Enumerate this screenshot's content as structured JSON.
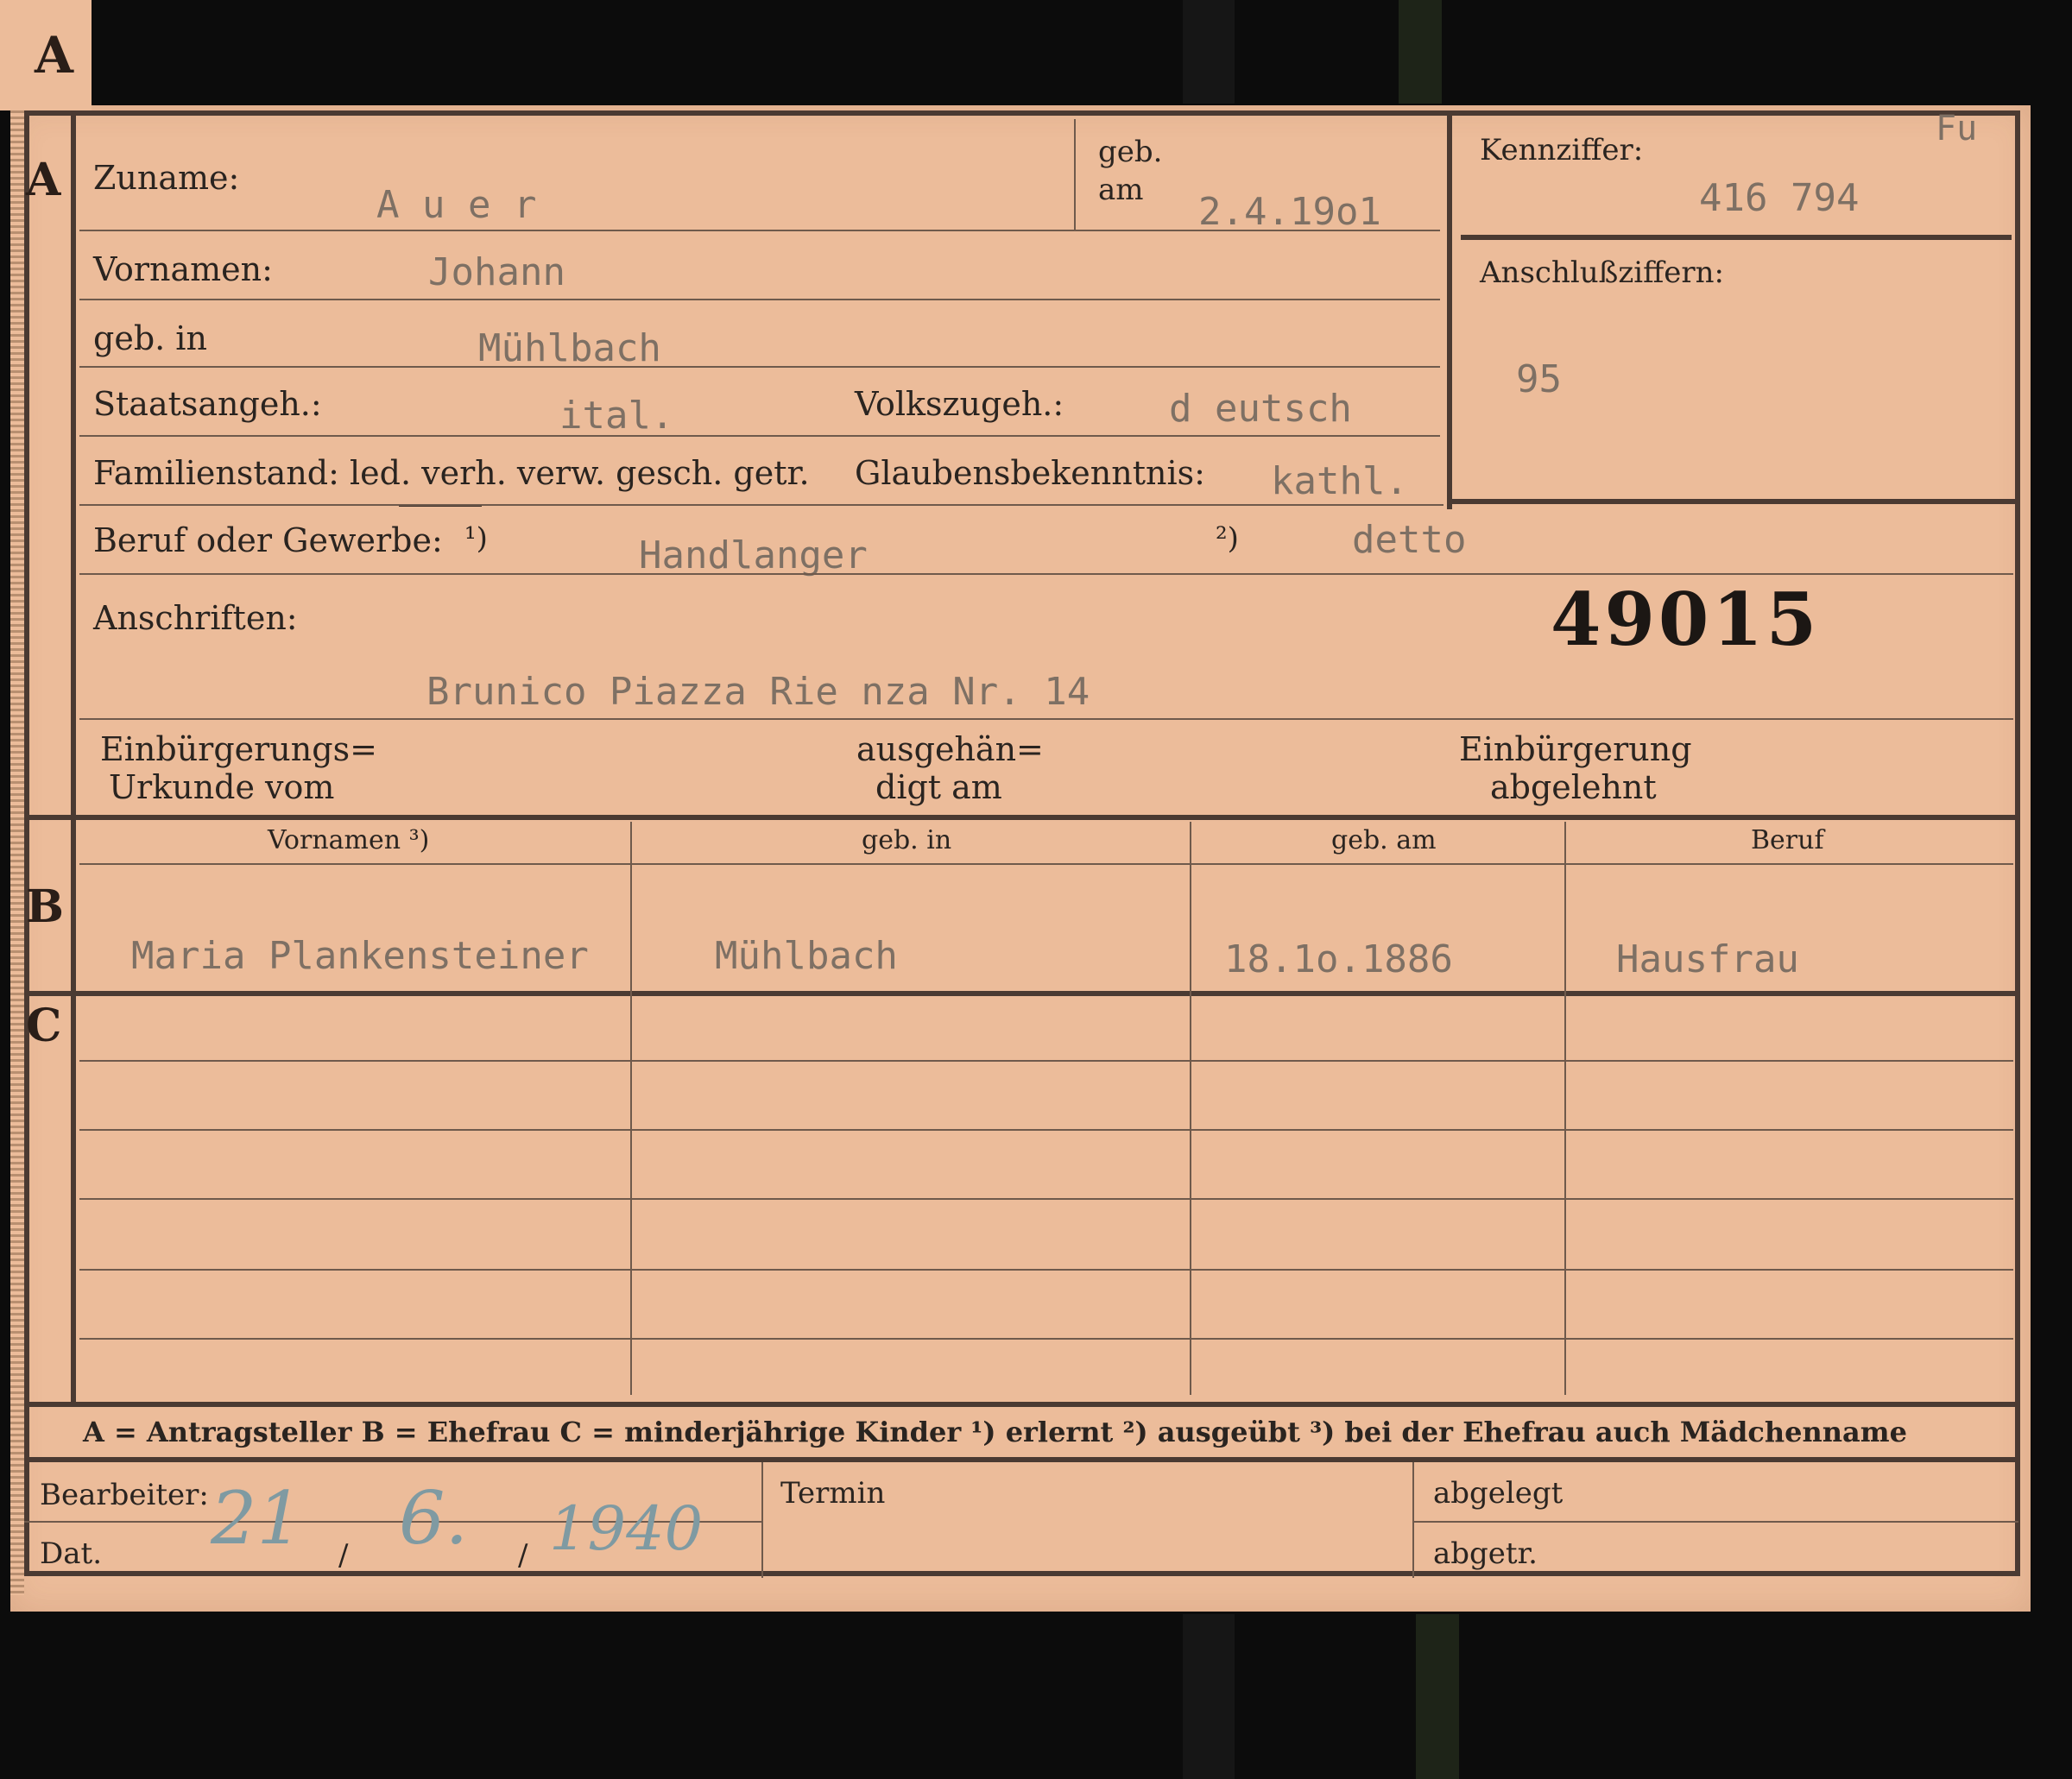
{
  "sections": {
    "a": "A",
    "b": "B",
    "c": "C"
  },
  "top_right_mark": "Fu",
  "applicant": {
    "surname_label": "Zuname:",
    "surname": "A u e r",
    "born_label_1": "geb.",
    "born_label_2": "am",
    "birth_date": "2.4.19o1",
    "firstname_label": "Vornamen:",
    "firstname": "Johann",
    "birthplace_label": "geb. in",
    "birthplace": "Mühlbach",
    "citizenship_label": "Staatsangeh.:",
    "citizenship": "ital.",
    "ethnicity_label": "Volkszugeh.:",
    "ethnicity": "d eutsch",
    "marital_label": "Familienstand: led. verh. verw. gesch. getr.",
    "religion_label": "Glaubensbekenntnis:",
    "religion": "kathl.",
    "occupation_label": "Beruf oder Gewerbe:",
    "footnote1": "¹)",
    "occupation_learned": "Handlanger",
    "footnote2": "²)",
    "occupation_practiced": "detto",
    "address_label": "Anschriften:",
    "record_number": "49015",
    "address": "Brunico Piazza  Rie nza  Nr. 14",
    "naturalization_label_1": "Einbürgerungs=",
    "naturalization_label_2": "Urkunde vom",
    "handed_label_1": "ausgehän=",
    "handed_label_2": "digt am",
    "rejected_label_1": "Einbürgerung",
    "rejected_label_2": "abgelehnt"
  },
  "id_box": {
    "kennziffer_label": "Kennziffer:",
    "kennziffer": "416 794",
    "anschluss_label": "Anschlußziffern:",
    "anschluss": "95"
  },
  "family_table": {
    "headers": [
      "Vornamen ³)",
      "geb. in",
      "geb. am",
      "Beruf"
    ],
    "wife": [
      "Maria Plankensteiner",
      "Mühlbach",
      "18.1o.1886",
      "Hausfrau"
    ]
  },
  "legend": "A = Antragsteller   B = Ehefrau   C = minderjährige Kinder   ¹) erlernt   ²) ausgeübt   ³) bei der Ehefrau auch Mädchenname",
  "footer": {
    "bearbeiter_label": "Bearbeiter:",
    "dat_label": "Dat.",
    "date_day": "21",
    "date_month": "6.",
    "date_year": "1940",
    "slash": "/",
    "termin_label": "Termin",
    "abgelegt_label": "abgelegt",
    "abgetr_label": "abgetr."
  }
}
